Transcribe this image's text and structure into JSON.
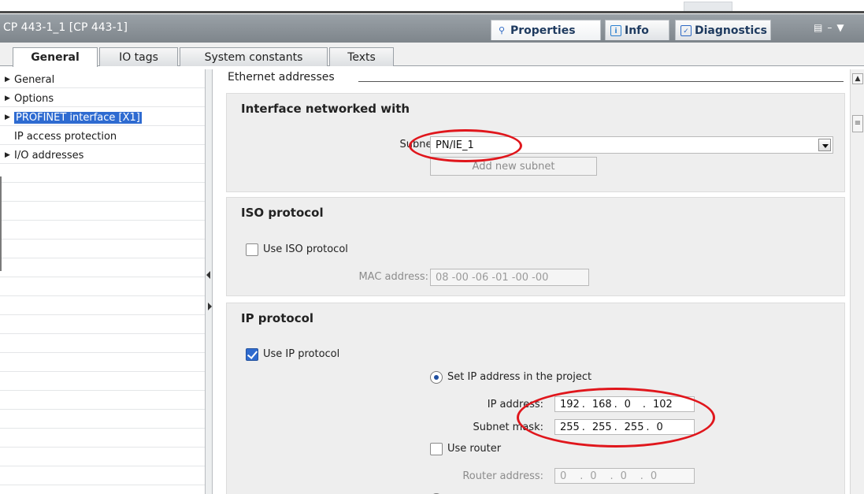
{
  "window": {
    "title": "CP 443-1_1 [CP 443-1]"
  },
  "inspector_tabs": [
    {
      "label": "Properties",
      "icon": "properties-icon",
      "active": true
    },
    {
      "label": "Info",
      "icon": "info-icon",
      "active": false
    },
    {
      "label": "Diagnostics",
      "icon": "diagnostics-icon",
      "active": false
    }
  ],
  "sub_tabs": [
    {
      "label": "General",
      "active": true
    },
    {
      "label": "IO tags",
      "active": false
    },
    {
      "label": "System constants",
      "active": false
    },
    {
      "label": "Texts",
      "active": false
    }
  ],
  "tree": [
    {
      "label": "General",
      "has_arrow": true,
      "selected": false
    },
    {
      "label": "Options",
      "has_arrow": true,
      "selected": false
    },
    {
      "label": "PROFINET interface [X1]",
      "has_arrow": true,
      "selected": true
    },
    {
      "label": "IP access protection",
      "has_arrow": false,
      "selected": false
    },
    {
      "label": "I/O addresses",
      "has_arrow": true,
      "selected": false
    }
  ],
  "section": {
    "heading": "Ethernet addresses"
  },
  "networked": {
    "title": "Interface networked with",
    "subnet_label": "Subnet:",
    "subnet_value": "PN/IE_1",
    "add_subnet_button": "Add new subnet"
  },
  "iso": {
    "title": "ISO protocol",
    "use_label": "Use ISO protocol",
    "use_checked": false,
    "mac_label": "MAC address:",
    "mac_value": "08 -00 -06 -01 -00 -00"
  },
  "ip": {
    "title": "IP protocol",
    "use_label": "Use IP protocol",
    "use_checked": true,
    "set_in_project_label": "Set IP address in the project",
    "ip_label": "IP address:",
    "ip_octets": [
      "192",
      "168",
      "0",
      "102"
    ],
    "mask_label": "Subnet mask:",
    "mask_octets": [
      "255",
      "255",
      "255",
      "0"
    ],
    "router_label": "Use router",
    "router_checked": false,
    "router_addr_label": "Router address:",
    "router_octets": [
      "0",
      "0",
      "0",
      "0"
    ]
  },
  "colors": {
    "annotation": "#e0161c",
    "selection": "#2e6bd1",
    "titlebar": "#8a9096"
  }
}
